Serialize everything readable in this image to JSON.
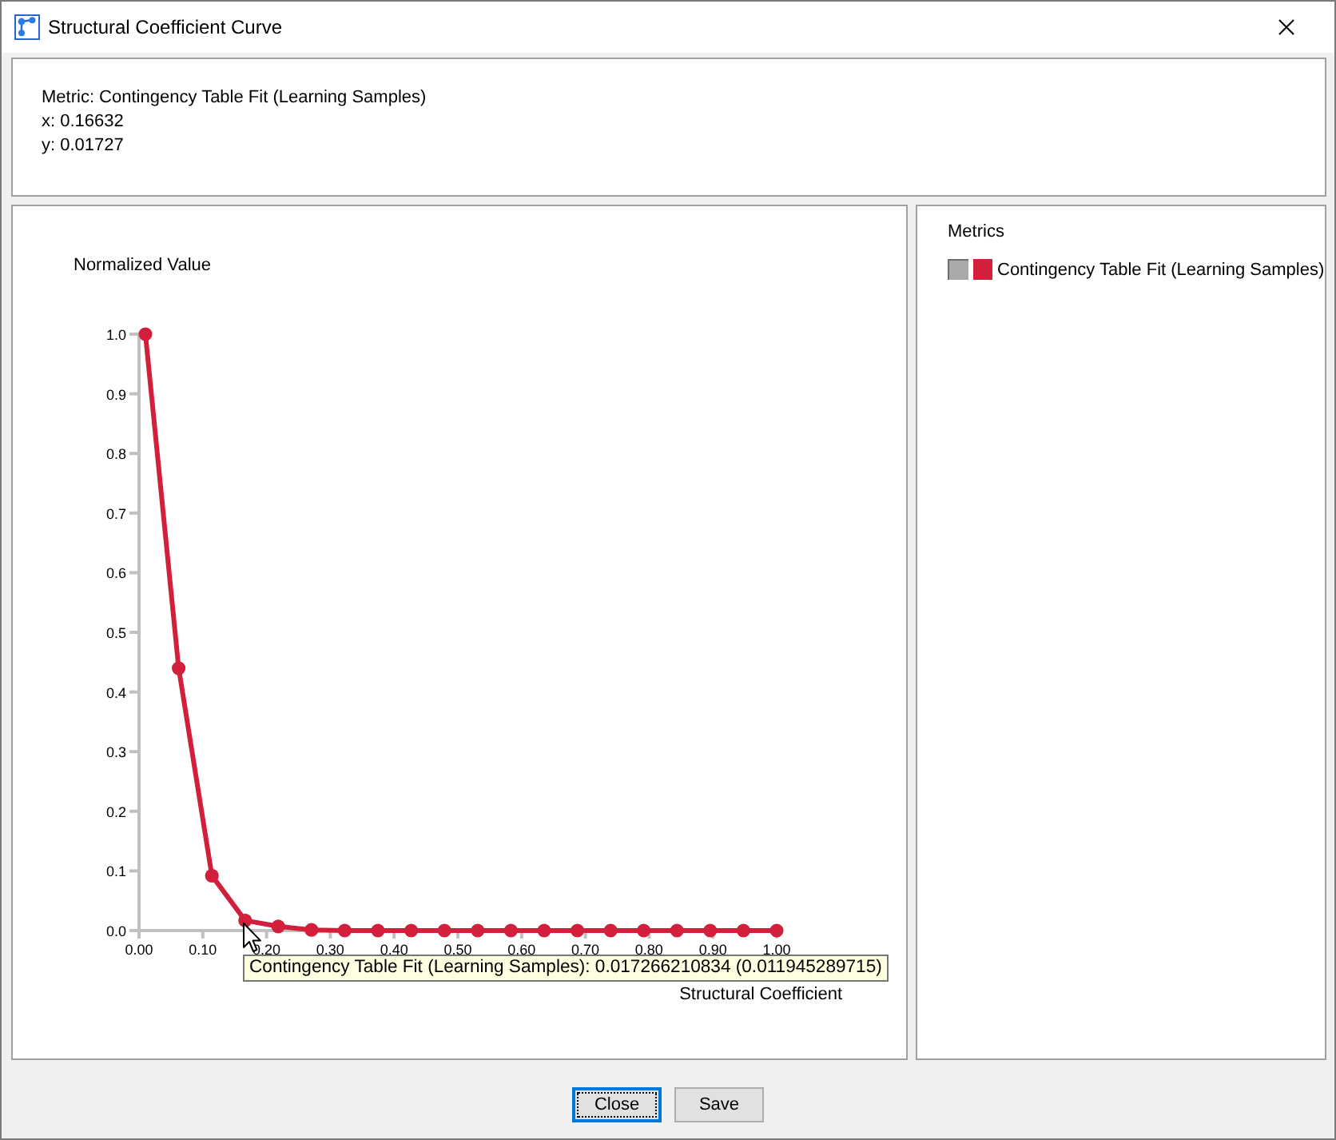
{
  "window": {
    "title": "Structural Coefficient Curve"
  },
  "info_panel": {
    "lines": [
      "Metric: Contingency Table Fit (Learning Samples)",
      "x: 0.16632",
      "y: 0.01727"
    ]
  },
  "chart": {
    "chart_data": {
      "type": "line",
      "xlabel": "Structural Coefficient",
      "ylabel": "Normalized Value",
      "x": [
        0.01,
        0.0621,
        0.1142,
        0.1663,
        0.2184,
        0.2705,
        0.3226,
        0.3747,
        0.4268,
        0.4789,
        0.5311,
        0.5832,
        0.6353,
        0.6874,
        0.7395,
        0.7916,
        0.8437,
        0.8958,
        0.9479,
        1.0
      ],
      "series": [
        {
          "name": "Contingency Table Fit (Learning Samples)",
          "color": "#d21f3c",
          "marker": "circle",
          "values": [
            1.0,
            0.44,
            0.092,
            0.017,
            0.007,
            0.001,
            0,
            0,
            0,
            0,
            0,
            0,
            0,
            0,
            0,
            0,
            0,
            0,
            0,
            0
          ]
        }
      ],
      "xlim": [
        0,
        1
      ],
      "ylim": [
        0,
        1
      ],
      "xticks": [
        {
          "value": 0,
          "label": "0.00"
        },
        {
          "value": 0.1,
          "label": "0.10"
        },
        {
          "value": 0.2,
          "label": "0.20"
        },
        {
          "value": 0.3,
          "label": "0.30"
        },
        {
          "value": 0.4,
          "label": "0.40"
        },
        {
          "value": 0.5,
          "label": "0.50"
        },
        {
          "value": 0.6,
          "label": "0.60"
        },
        {
          "value": 0.7,
          "label": "0.70"
        },
        {
          "value": 0.8,
          "label": "0.80"
        },
        {
          "value": 0.9,
          "label": "0.90"
        },
        {
          "value": 1,
          "label": "1.00"
        }
      ],
      "yticks": [
        {
          "value": 0,
          "label": "0.0"
        },
        {
          "value": 0.1,
          "label": "0.1"
        },
        {
          "value": 0.2,
          "label": "0.2"
        },
        {
          "value": 0.3,
          "label": "0.3"
        },
        {
          "value": 0.4,
          "label": "0.4"
        },
        {
          "value": 0.5,
          "label": "0.5"
        },
        {
          "value": 0.6,
          "label": "0.6"
        },
        {
          "value": 0.7,
          "label": "0.7"
        },
        {
          "value": 0.8,
          "label": "0.8"
        },
        {
          "value": 0.9,
          "label": "0.9"
        },
        {
          "value": 1,
          "label": "1.0"
        }
      ]
    },
    "tooltip": "Contingency Table Fit (Learning Samples): 0.017266210834 (0.011945289715)"
  },
  "legend": {
    "title": "Metrics"
  },
  "buttons": [
    {
      "label": "Close",
      "focused": true
    },
    {
      "label": "Save",
      "focused": false
    }
  ]
}
